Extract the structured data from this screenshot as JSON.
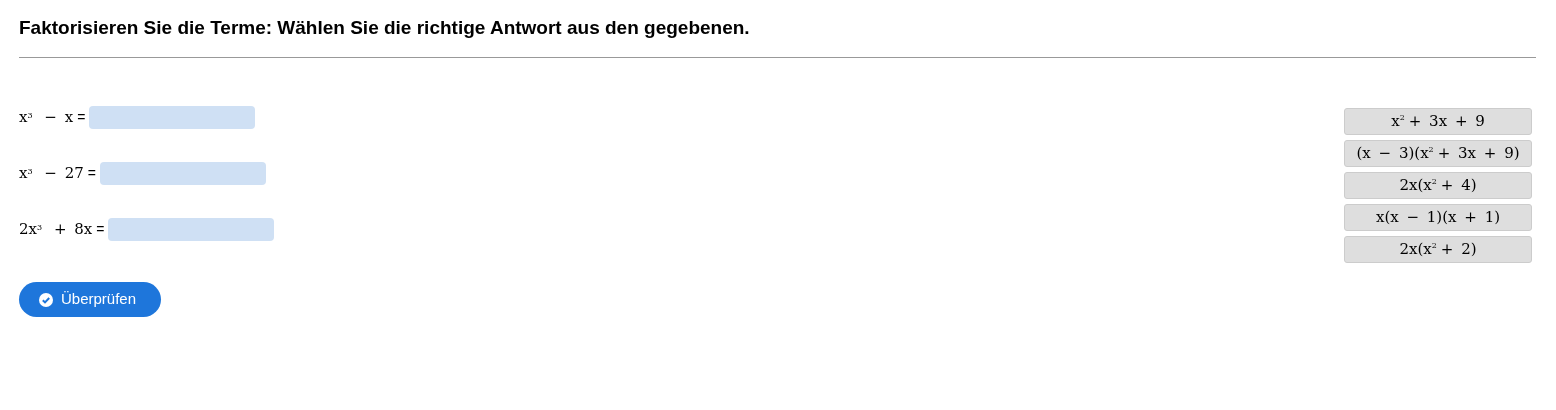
{
  "title": "Faktorisieren Sie die Terme: Wählen Sie die richtige Antwort aus den gegebenen.",
  "questions": [
    {
      "term": "x$^{3}$ − x",
      "equals": "="
    },
    {
      "term": "x$^{3}$ − 27",
      "equals": "="
    },
    {
      "term": "2x$^{3}$ + 8x",
      "equals": "="
    }
  ],
  "options": [
    "x$^{2}$ + 3x + 9",
    "(x − 3)(x$^{2}$ + 3x + 9)",
    "2x(x$^{2}$ + 4)",
    "x(x − 1)(x + 1)",
    "2x(x$^{2}$ + 2)"
  ],
  "check_button": {
    "label": "Überprüfen"
  }
}
